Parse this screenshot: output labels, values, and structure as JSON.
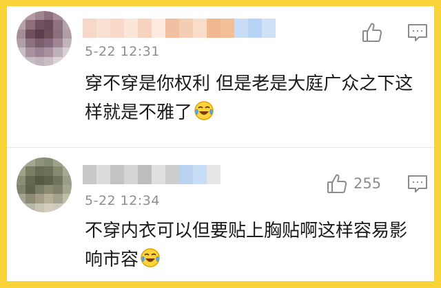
{
  "comments": [
    {
      "time": "5-22 12:31",
      "text": "穿不穿是你权利 但是老是大庭广众之下这样就是不雅了",
      "emoji": "crying-laughing-emoji",
      "like_count": "",
      "avatar_colors": [
        "#c7b3b6",
        "#b49aa2",
        "#9f8590",
        "#8d6f7d",
        "#a58c98",
        "#c3b3bb",
        "#b6a1a8",
        "#8e6e7b",
        "#6f5060",
        "#6a4a5a",
        "#8f7281",
        "#b5a3ab",
        "#a68c96",
        "#6e4f5e",
        "#5b3f4d",
        "#6d4f5c",
        "#8b6f7b",
        "#b09ca5",
        "#b19fa7",
        "#8c717e",
        "#7b5f6d",
        "#86697a",
        "#9e8793",
        "#c0b3b9",
        "#c9bdc2",
        "#a992a0",
        "#9c8494",
        "#a8909e",
        "#bfb1b8",
        "#d7cfd3",
        "#d9d3d6",
        "#c8bcc3",
        "#c2b4bc",
        "#cbbfc5",
        "#dad4d7",
        "#e6e1e3"
      ],
      "name_colors": [
        "#f7d7c8",
        "#f9e2d4",
        "#f8d9c9",
        "#fbe6d9",
        "#f6d2c0",
        "#fde9dd",
        "#f2c0a0",
        "#f5cdb4",
        "#f9ddc9",
        "#f1b98f",
        "#f3bf96",
        "#c8dcf5",
        "#b8d3f5",
        "#cfe1f7"
      ]
    },
    {
      "time": "5-22 12:34",
      "text": "不穿内衣可以但要贴上胸贴啊这样容易影响市容",
      "emoji": "crying-laughing-emoji",
      "like_count": "255",
      "avatar_colors": [
        "#b7bba8",
        "#a3a892",
        "#8d9278",
        "#868b73",
        "#9ea28d",
        "#bcbfae",
        "#9fa38c",
        "#7a7f63",
        "#676c52",
        "#6c7058",
        "#858a70",
        "#a6a994",
        "#8a8e76",
        "#646850",
        "#55593f",
        "#5d6148",
        "#70745b",
        "#999c86",
        "#7e826b",
        "#5f634a",
        "#7a7c63",
        "#8c8a70",
        "#7f8168",
        "#a4a690",
        "#a2a48f",
        "#8b8a74",
        "#a39c84",
        "#b7ae96",
        "#a3a28c",
        "#bdbfae",
        "#c4c6b8",
        "#b7b7a6",
        "#c9c3b2",
        "#d3cdbe",
        "#cdcbbd",
        "#d9d8cf"
      ],
      "name_colors": [
        "#c9c9c9",
        "#dcdcdc",
        "#c3c3c3",
        "#d4d4d4",
        "#bdbdbd",
        "#e0e0e0",
        "#cdcdcd",
        "#b8d2f0",
        "#c7dcf5",
        "#e6e6e6"
      ]
    }
  ],
  "colors": {
    "background": "#f7d338",
    "card": "#ffffff",
    "meta_text": "#8e8e8e",
    "body_text": "#1a1a1a"
  }
}
